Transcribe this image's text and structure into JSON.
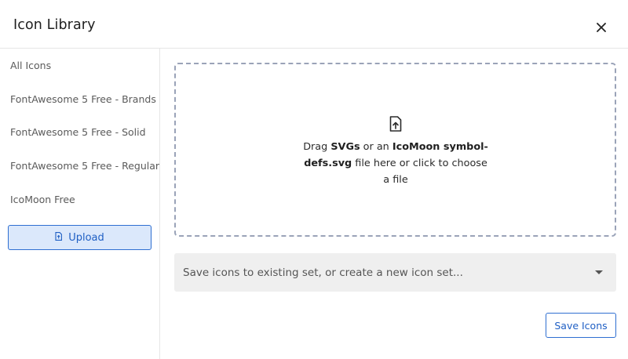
{
  "dialog": {
    "title": "Icon Library",
    "close_icon": "close-icon"
  },
  "sidebar": {
    "items": [
      {
        "label": "All Icons"
      },
      {
        "label": "FontAwesome 5 Free - Brands"
      },
      {
        "label": "FontAwesome 5 Free - Solid"
      },
      {
        "label": "FontAwesome 5 Free - Regular"
      },
      {
        "label": "IcoMoon Free"
      }
    ],
    "upload_button": {
      "label": "Upload",
      "icon": "file-upload-icon"
    }
  },
  "dropzone": {
    "icon": "file-upload-icon",
    "text_prefix": "Drag ",
    "text_strong1": "SVGs",
    "text_mid": " or an ",
    "text_strong2": "IcoMoon symbol-defs.svg",
    "text_suffix": " file here or click to choose a file"
  },
  "icon_set_select": {
    "placeholder": "Save icons to existing set, or create a new icon set...",
    "caret_icon": "caret-down-icon"
  },
  "save_button": {
    "label": "Save Icons"
  },
  "colors": {
    "accent": "#2f6fd1",
    "upload_bg": "#dbe8fb",
    "select_bg": "#efefef",
    "dropzone_border": "#9aa3b8"
  }
}
